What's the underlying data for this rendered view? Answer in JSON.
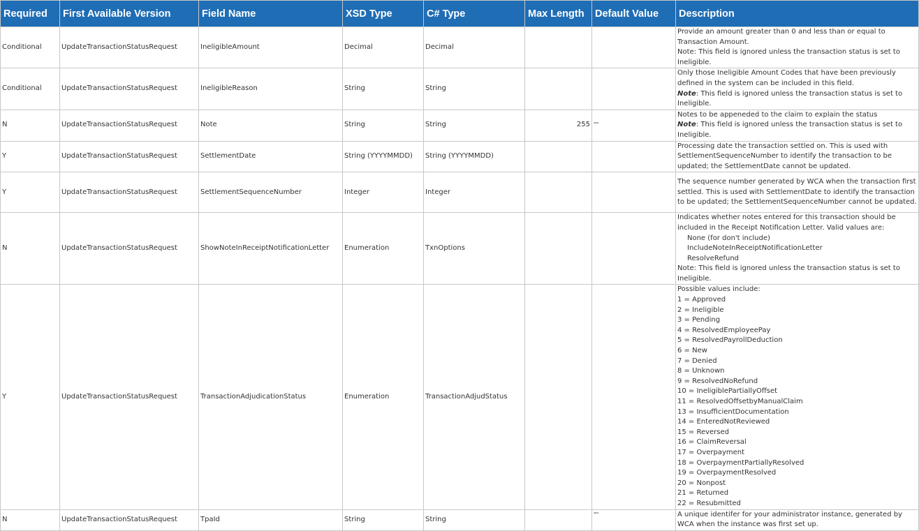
{
  "headers": {
    "required": "Required",
    "version": "First Available Version",
    "field": "Field Name",
    "xsd": "XSD Type",
    "csharp": "C# Type",
    "maxlen": "Max Length",
    "default": "Default Value",
    "desc": "Description"
  },
  "rows": [
    {
      "required": "Conditional",
      "version": "UpdateTransactionStatusRequest",
      "field": "IneligibleAmount",
      "xsd": "Decimal",
      "csharp": "Decimal",
      "maxlen": "",
      "default": "",
      "desc": [
        "Provide an amount greater than 0 and less than or equal to Transaction Amount.",
        "Note: This field is ignored unless the transaction status is set to Ineligible."
      ]
    },
    {
      "required": "Conditional",
      "version": "UpdateTransactionStatusRequest",
      "field": "IneligibleReason",
      "xsd": "String",
      "csharp": "String",
      "maxlen": "",
      "default": "",
      "desc": [
        "Only those Ineligible Amount Codes that have been previously defined in the system can be included in this field."
      ],
      "note_label": "Note",
      "note_text": ": This field is ignored unless the transaction status is set to Ineligible."
    },
    {
      "required": "N",
      "version": "UpdateTransactionStatusRequest",
      "field": "Note",
      "xsd": "String",
      "csharp": "String",
      "maxlen": "255",
      "default": "\"\"",
      "desc": [
        "Notes to be appeneded to the claim to explain the status"
      ],
      "note_label": "Note",
      "note_text": ": This field is ignored unless the transaction status is set to Ineligible."
    },
    {
      "required": "Y",
      "version": "UpdateTransactionStatusRequest",
      "field": "SettlementDate",
      "xsd": "String (YYYYMMDD)",
      "csharp": "String (YYYYMMDD)",
      "maxlen": "",
      "default": "",
      "desc": [
        "Processing date the transaction settled on. This is used with SettlementSequenceNumber to identify the transaction to be updated; the SettlementDate cannot be updated."
      ]
    },
    {
      "required": "Y",
      "version": "UpdateTransactionStatusRequest",
      "field": "SettlementSequenceNumber",
      "xsd": "Integer",
      "csharp": "Integer",
      "maxlen": "",
      "default": "",
      "desc": [
        "The sequence number generated by WCA when the transaction first settled. This is used with SettlementDate to identify the transaction to be updated; the SettlementSequenceNumber cannot be updated."
      ]
    },
    {
      "required": "N",
      "version": "UpdateTransactionStatusRequest",
      "field": "ShowNoteInReceiptNotificationLetter",
      "xsd": "Enumeration",
      "csharp": "TxnOptions",
      "maxlen": "",
      "default": "",
      "desc": [
        "Indicates whether notes entered for this transaction should be included in the Receipt Notification Letter. Valid values are:"
      ],
      "options": [
        "None (for don't include)",
        "IncludeNoteInReceiptNotificationLetter",
        "ResolveRefund"
      ],
      "desc_after": "Note: This field is ignored unless the transaction status is set to Ineligible."
    },
    {
      "required": "Y",
      "version": "UpdateTransactionStatusRequest",
      "field": "TransactionAdjudicationStatus",
      "xsd": "Enumeration",
      "csharp": "TransactionAdjudStatus",
      "maxlen": "",
      "default": "",
      "desc": [
        "Possible values include:",
        "1 = Approved",
        "2 = Ineligible",
        "3 = Pending",
        "4 = ResolvedEmployeePay",
        "5 = ResolvedPayrollDeduction",
        "6 = New",
        "7 = Denied",
        "8 = Unknown",
        "9 = ResolvedNoRefund",
        "10 = IneligiblePartiallyOffset",
        "11 = ResolvedOffsetbyManualClaim",
        "13 = InsufficientDocumentation",
        "14 = EnteredNotReviewed",
        "15 = Reversed",
        "16 = ClaimReversal",
        "17 = Overpayment",
        "18 = OverpaymentPartiallyResolved",
        "19 = OverpaymentResolved",
        "20 = Nonpost",
        "21 = Returned",
        "22 = Resubmitted"
      ]
    },
    {
      "required": "N",
      "version": "UpdateTransactionStatusRequest",
      "field": "TpaId",
      "xsd": "String",
      "csharp": "String",
      "maxlen": "",
      "default": "\"\"",
      "desc": [
        "A unique identifer for your administrator instance, generated by WCA when the instance was first set up."
      ]
    }
  ]
}
